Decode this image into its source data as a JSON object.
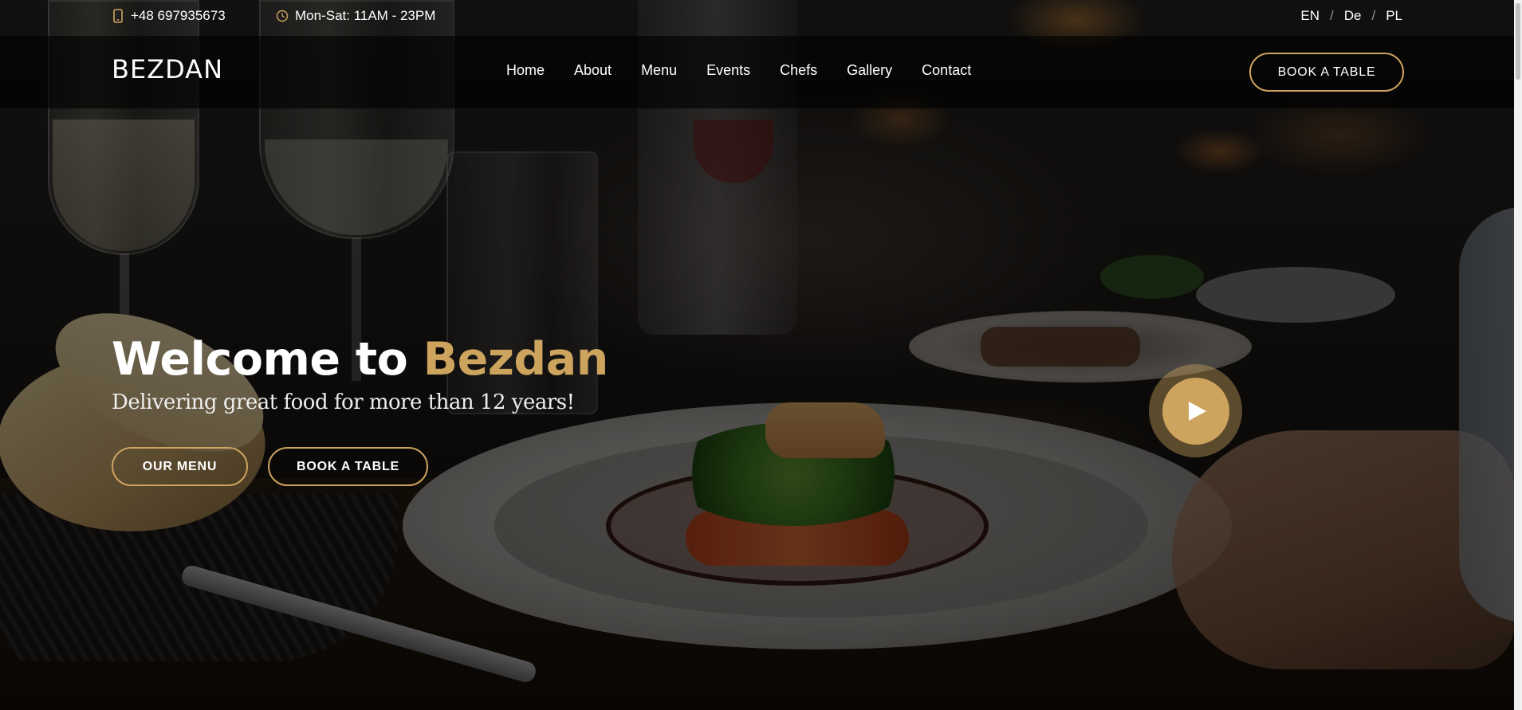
{
  "topbar": {
    "phone": {
      "icon": "phone-icon",
      "text": "+48 697935673"
    },
    "hours": {
      "icon": "clock-icon",
      "text": "Mon-Sat: 11AM - 23PM"
    },
    "languages": [
      {
        "code": "EN"
      },
      {
        "code": "De"
      },
      {
        "code": "PL"
      }
    ],
    "language_separator": "/"
  },
  "header": {
    "logo": "BEZDAN",
    "nav": [
      {
        "label": "Home"
      },
      {
        "label": "About"
      },
      {
        "label": "Menu"
      },
      {
        "label": "Events"
      },
      {
        "label": "Chefs"
      },
      {
        "label": "Gallery"
      },
      {
        "label": "Contact"
      }
    ],
    "cta_label": "BOOK A TABLE"
  },
  "hero": {
    "title_prefix": "Welcome to",
    "title_accent": "Bezdan",
    "subtitle": "Delivering great food for more than 12 years!",
    "buttons": {
      "menu": "OUR MENU",
      "book": "BOOK A TABLE"
    },
    "play_button_icon": "play-icon"
  },
  "colors": {
    "accent": "#cda45e",
    "text": "#ffffff",
    "header_bg": "rgba(0,0,0,0.62)"
  }
}
